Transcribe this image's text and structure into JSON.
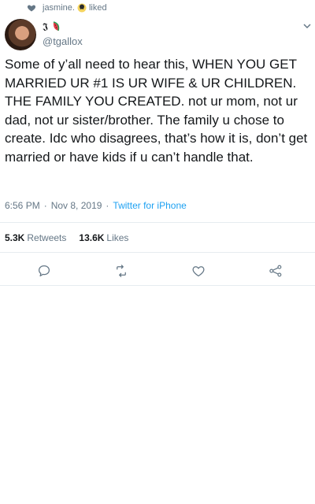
{
  "social_context": {
    "user": "jasmine.",
    "action": "liked"
  },
  "tweet": {
    "author_handle": "@tgallox",
    "text": "Some of y’all need to hear this,  WHEN YOU GET MARRIED UR #1 IS UR WIFE & UR CHILDREN. THE FAMILY YOU CREATED. not ur mom, not ur dad, not ur sister/brother. The family u chose to create. Idc who disagrees, that’s how it is, don’t get married or have kids if u can’t handle that.",
    "time": "6:56 PM",
    "date": "Nov 8, 2019",
    "source": "Twitter for iPhone"
  },
  "stats": {
    "retweets_count": "5.3K",
    "retweets_label": "Retweets",
    "likes_count": "13.6K",
    "likes_label": "Likes"
  },
  "colors": {
    "link": "#1da1f2",
    "secondary": "#657786",
    "text": "#14171a",
    "divider": "#e6ecf0"
  },
  "icons": [
    "heart-icon",
    "chevron-down-icon",
    "reply-icon",
    "retweet-icon",
    "like-icon",
    "share-icon"
  ]
}
